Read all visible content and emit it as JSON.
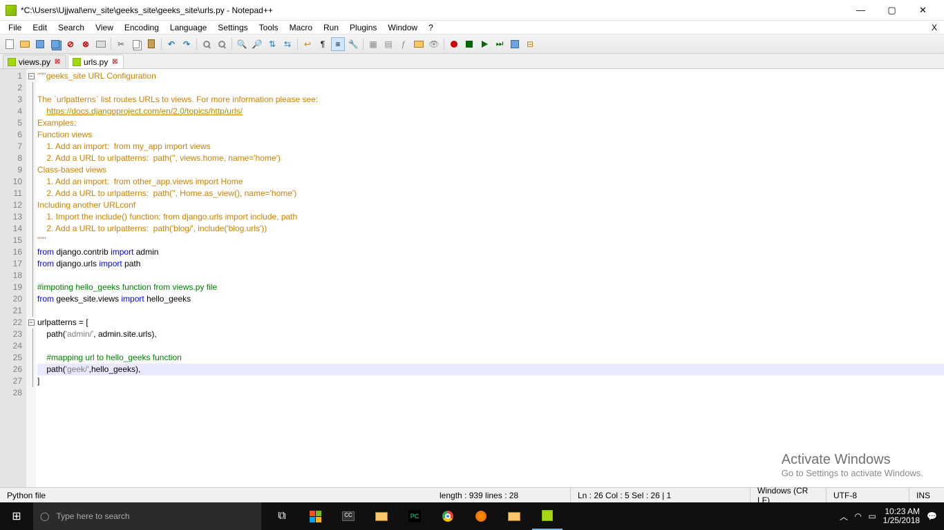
{
  "titlebar": {
    "text": "*C:\\Users\\Ujjwal\\env_site\\geeks_site\\geeks_site\\urls.py - Notepad++"
  },
  "menubar": [
    "File",
    "Edit",
    "Search",
    "View",
    "Encoding",
    "Language",
    "Settings",
    "Tools",
    "Macro",
    "Run",
    "Plugins",
    "Window",
    "?"
  ],
  "tabs": [
    {
      "label": "views.py",
      "active": false
    },
    {
      "label": "urls.py",
      "active": true
    }
  ],
  "code": {
    "lines": [
      {
        "n": 1,
        "fold": "minus",
        "seg": [
          {
            "c": "s-doc",
            "t": "\"\"\"geeks_site URL Configuration"
          }
        ]
      },
      {
        "n": 2,
        "seg": []
      },
      {
        "n": 3,
        "seg": [
          {
            "c": "s-doc",
            "t": "The `urlpatterns` list routes URLs to views. For more information please see:"
          }
        ]
      },
      {
        "n": 4,
        "seg": [
          {
            "c": "s-doc",
            "t": "    "
          },
          {
            "c": "s-doc-link",
            "t": "https://docs.djangoproject.com/en/2.0/topics/http/urls/"
          }
        ]
      },
      {
        "n": 5,
        "seg": [
          {
            "c": "s-doc",
            "t": "Examples:"
          }
        ]
      },
      {
        "n": 6,
        "seg": [
          {
            "c": "s-doc",
            "t": "Function views"
          }
        ]
      },
      {
        "n": 7,
        "seg": [
          {
            "c": "s-doc",
            "t": "    1. Add an import:  from my_app import views"
          }
        ]
      },
      {
        "n": 8,
        "seg": [
          {
            "c": "s-doc",
            "t": "    2. Add a URL to urlpatterns:  path('', views.home, name='home')"
          }
        ]
      },
      {
        "n": 9,
        "seg": [
          {
            "c": "s-doc",
            "t": "Class-based views"
          }
        ]
      },
      {
        "n": 10,
        "seg": [
          {
            "c": "s-doc",
            "t": "    1. Add an import:  from other_app.views import Home"
          }
        ]
      },
      {
        "n": 11,
        "seg": [
          {
            "c": "s-doc",
            "t": "    2. Add a URL to urlpatterns:  path('', Home.as_view(), name='home')"
          }
        ]
      },
      {
        "n": 12,
        "seg": [
          {
            "c": "s-doc",
            "t": "Including another URLconf"
          }
        ]
      },
      {
        "n": 13,
        "seg": [
          {
            "c": "s-doc",
            "t": "    1. Import the include() function: from django.urls import include, path"
          }
        ]
      },
      {
        "n": 14,
        "seg": [
          {
            "c": "s-doc",
            "t": "    2. Add a URL to urlpatterns:  path('blog/', include('blog.urls'))"
          }
        ]
      },
      {
        "n": 15,
        "seg": [
          {
            "c": "s-doc",
            "t": "\"\"\""
          }
        ]
      },
      {
        "n": 16,
        "seg": [
          {
            "c": "s-kw",
            "t": "from"
          },
          {
            "t": " django.contrib "
          },
          {
            "c": "s-kw",
            "t": "import"
          },
          {
            "t": " admin"
          }
        ]
      },
      {
        "n": 17,
        "seg": [
          {
            "c": "s-kw",
            "t": "from"
          },
          {
            "t": " django.urls "
          },
          {
            "c": "s-kw",
            "t": "import"
          },
          {
            "t": " path"
          }
        ]
      },
      {
        "n": 18,
        "seg": []
      },
      {
        "n": 19,
        "seg": [
          {
            "c": "s-cmt",
            "t": "#impoting hello_geeks function from views.py file"
          }
        ]
      },
      {
        "n": 20,
        "seg": [
          {
            "c": "s-kw",
            "t": "from"
          },
          {
            "t": " geeks_site.views "
          },
          {
            "c": "s-kw",
            "t": "import"
          },
          {
            "t": " hello_geeks"
          }
        ]
      },
      {
        "n": 21,
        "seg": []
      },
      {
        "n": 22,
        "fold": "minus",
        "seg": [
          {
            "t": "urlpatterns = ["
          }
        ]
      },
      {
        "n": 23,
        "seg": [
          {
            "t": "    path("
          },
          {
            "c": "s-str",
            "t": "'admin/'"
          },
          {
            "t": ", admin.site.urls),"
          }
        ]
      },
      {
        "n": 24,
        "seg": []
      },
      {
        "n": 25,
        "seg": [
          {
            "t": "    "
          },
          {
            "c": "s-cmt",
            "t": "#mapping url to hello_geeks function"
          }
        ]
      },
      {
        "n": 26,
        "hl": true,
        "seg": [
          {
            "t": "    path("
          },
          {
            "c": "s-str",
            "t": "'geek/'"
          },
          {
            "t": ",hello_geeks),"
          }
        ]
      },
      {
        "n": 27,
        "seg": [
          {
            "t": "]"
          }
        ]
      },
      {
        "n": 28,
        "seg": []
      }
    ]
  },
  "statusbar": {
    "left": "Python file",
    "length": "length : 939    lines : 28",
    "pos": "Ln : 26    Col : 5    Sel : 26 | 1",
    "eol": "Windows (CR LF)",
    "enc": "UTF-8",
    "ins": "INS"
  },
  "watermark": {
    "big": "Activate Windows",
    "small": "Go to Settings to activate Windows."
  },
  "taskbar": {
    "search_placeholder": "Type here to search",
    "time": "10:23 AM",
    "date": "1/25/2018"
  }
}
